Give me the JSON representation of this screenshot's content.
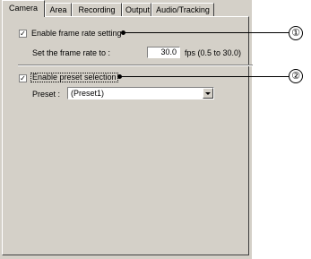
{
  "tabs": [
    "Camera",
    "Area",
    "Recording",
    "Output",
    "Audio/Tracking"
  ],
  "frame_rate": {
    "checkbox_label": "Enable frame rate setting",
    "checked": true,
    "set_label": "Set the frame rate to :",
    "value": "30.0",
    "range_hint": "fps (0.5 to 30.0)"
  },
  "preset": {
    "checkbox_label": "Enable preset selection",
    "checked": true,
    "label": "Preset :",
    "selected": "(Preset1)"
  },
  "callouts": [
    "①",
    "②"
  ],
  "check_mark": "✓"
}
